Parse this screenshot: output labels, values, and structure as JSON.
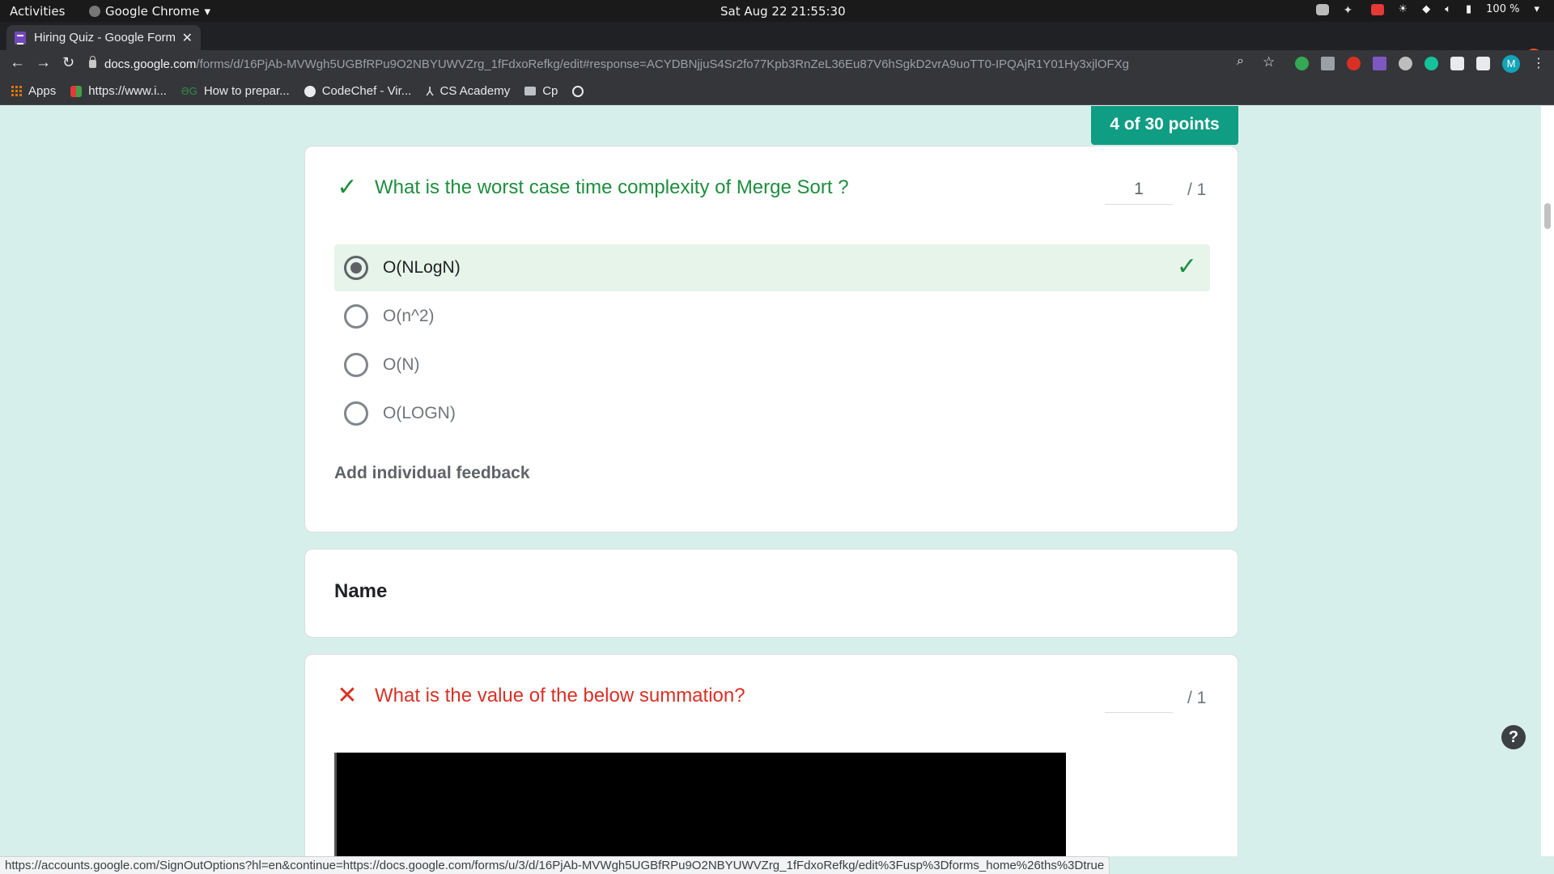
{
  "system_bar": {
    "activities": "Activities",
    "app_name": "Google Chrome",
    "clock": "Sat Aug 22  21:55:30",
    "battery": "100 %"
  },
  "browser": {
    "tab_title": "Hiring Quiz - Google Forms",
    "url_host": "docs.google.com",
    "url_path": "/forms/d/16PjAb-MVWgh5UGBfRPu9O2NBYUWVZrg_1fFdxoRefkg/edit#response=ACYDBNjjuS4Sr2fo77Kpb3RnZeL36Eu87V6hSgkD2vrA9uoTT0-IPQAjR1Y01Hy3xjlOFXg",
    "profile_initial": "M",
    "bookmarks": [
      {
        "label": "Apps",
        "icon": "apps-grid-icon"
      },
      {
        "label": "https://www.i...",
        "icon": "bookmark-favicon-icon"
      },
      {
        "label": "How to prepar...",
        "icon": "gfg-icon"
      },
      {
        "label": "CodeChef - Vir...",
        "icon": "codechef-icon"
      },
      {
        "label": "CS Academy",
        "icon": "csacademy-icon"
      },
      {
        "label": "Cp",
        "icon": "folder-icon"
      },
      {
        "label": "",
        "icon": "globe-icon"
      }
    ],
    "status_url": "https://accounts.google.com/SignOutOptions?hl=en&continue=https://docs.google.com/forms/u/3/d/16PjAb-MVWgh5UGBfRPu9O2NBYUWVZrg_1fFdxoRefkg/edit%3Fusp%3Dforms_home%26ths%3Dtrue"
  },
  "form": {
    "points_badge": "4 of 30 points",
    "question1": {
      "text": "What is the worst case time complexity of Merge Sort ?",
      "score_value": "1",
      "score_max": "/ 1",
      "options": [
        "O(NLogN)",
        "O(n^2)",
        "O(N)",
        "O(LOGN)"
      ],
      "selected_index": 0,
      "feedback_link": "Add individual feedback"
    },
    "name_card": {
      "title": "Name"
    },
    "question2": {
      "text": "What is the value of the below summation?",
      "score_value": "",
      "score_max": "/ 1"
    }
  },
  "colors": {
    "page_bg": "#d7efea",
    "badge": "#0f9d83",
    "correct": "#1e8e3e",
    "wrong": "#d93025",
    "selected_bg": "#e6f4ea"
  }
}
